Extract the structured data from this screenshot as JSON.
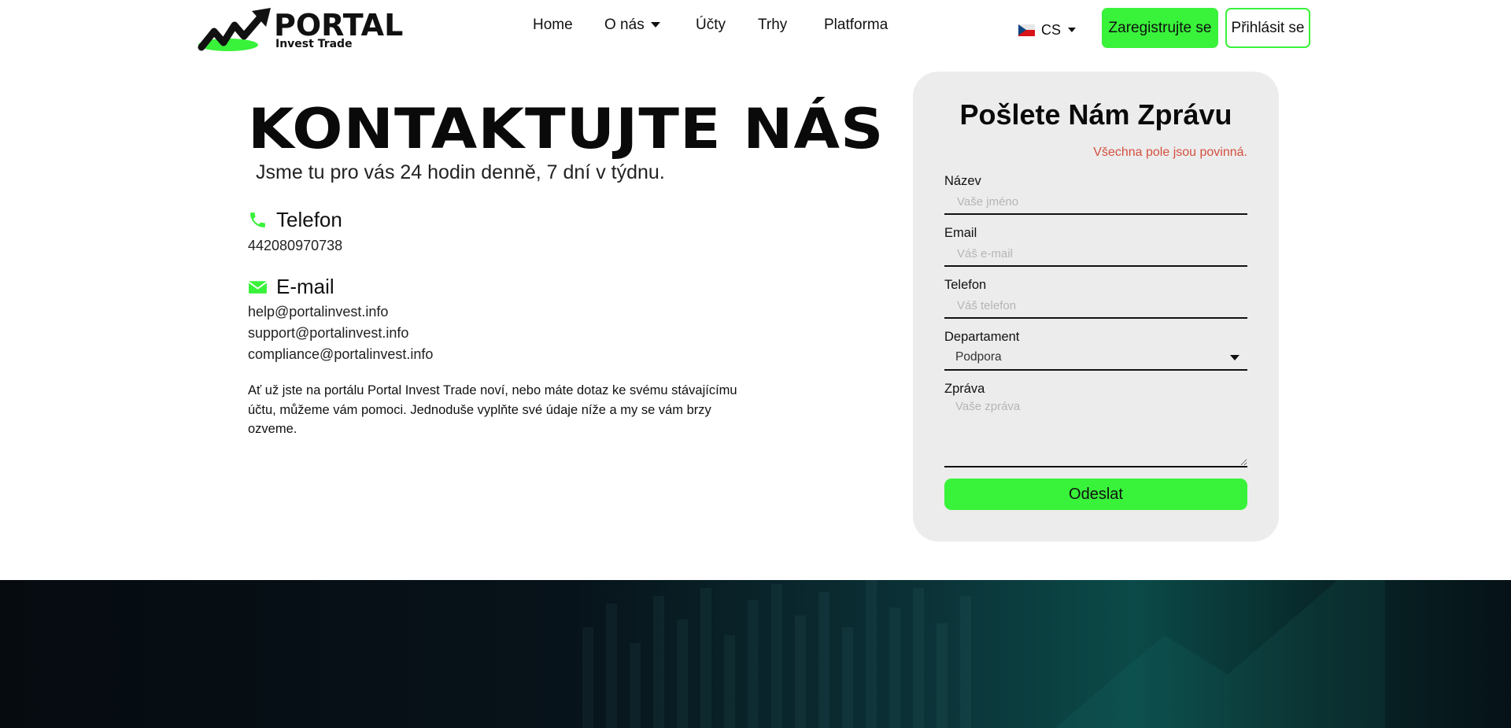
{
  "header": {
    "logo": {
      "word": "PORTAL",
      "sub": "Invest Trade"
    },
    "nav": [
      "Home",
      "O nás",
      "Účty",
      "Trhy",
      "Platforma"
    ],
    "language": "CS",
    "register_label": "Zaregistrujte se",
    "login_label": "Přihlásit se"
  },
  "contact": {
    "title": "KONTAKTUJTE NÁS",
    "subtitle": "Jsme tu pro vás 24 hodin denně, 7 dní v týdnu.",
    "phone_heading": "Telefon",
    "phone_number": "442080970738",
    "email_heading": "E-mail",
    "emails": [
      "help@portalinvest.info",
      "support@portalinvest.info",
      "compliance@portalinvest.info"
    ],
    "paragraph": "Ať už jste na portálu Portal Invest Trade noví, nebo máte dotaz ke svému stávajícímu účtu, můžeme vám pomoci. Jednoduše vyplňte své údaje níže a my se vám brzy ozveme."
  },
  "form": {
    "title": "Pošlete Nám Zprávu",
    "required_note": "Všechna pole jsou povinná.",
    "name_label": "Název",
    "name_placeholder": "Vaše jméno",
    "email_label": "Email",
    "email_placeholder": "Váš e-mail",
    "phone_label": "Telefon",
    "phone_placeholder": "Váš telefon",
    "department_label": "Departament",
    "department_value": "Podpora",
    "message_label": "Zpráva",
    "message_placeholder": "Vaše zpráva",
    "submit_label": "Odeslat"
  },
  "colors": {
    "accent_green": "#39f23a",
    "required_red": "#d4503f",
    "card_bg": "#ececec",
    "footer_dark": "#060b10",
    "footer_teal": "#0b4a48"
  },
  "icons": {
    "phone": "phone-icon",
    "email": "envelope-icon",
    "logo": "trend-arrow-logo"
  }
}
